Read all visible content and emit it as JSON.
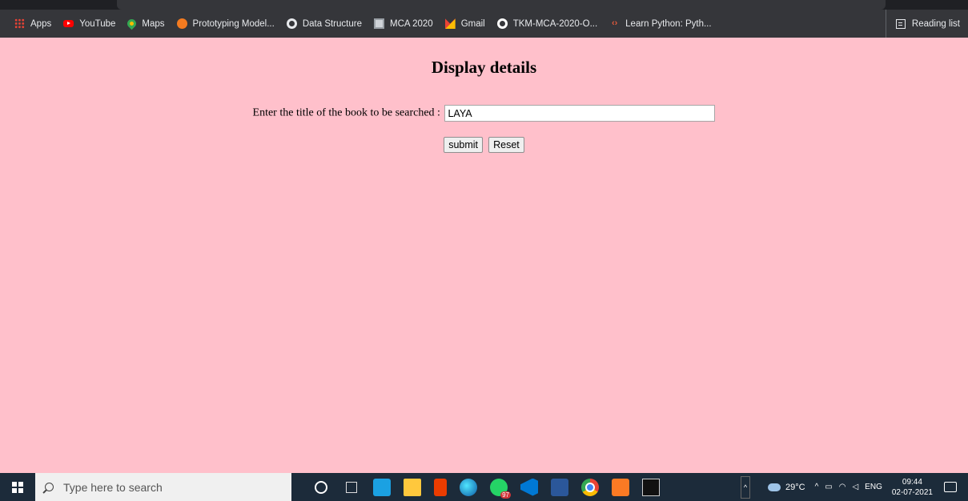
{
  "bookmarks": {
    "items": [
      {
        "label": "Apps",
        "icon": "apps-grid-icon"
      },
      {
        "label": "YouTube",
        "icon": "youtube-icon"
      },
      {
        "label": "Maps",
        "icon": "maps-pin-icon"
      },
      {
        "label": "Prototyping Model...",
        "icon": "prototyping-icon"
      },
      {
        "label": "Data Structure",
        "icon": "globe-icon"
      },
      {
        "label": "MCA 2020",
        "icon": "mca-icon"
      },
      {
        "label": "Gmail",
        "icon": "gmail-icon"
      },
      {
        "label": "TKM-MCA-2020-O...",
        "icon": "github-icon"
      },
      {
        "label": "Learn Python: Pyth...",
        "icon": "python-icon"
      }
    ],
    "reading_list": "Reading list"
  },
  "page": {
    "heading": "Display details",
    "search_label": "Enter the title of the book to be searched :",
    "search_value": "LAYA",
    "submit_label": "submit",
    "reset_label": "Reset",
    "background_color": "#ffc0cb"
  },
  "taskbar": {
    "search_placeholder": "Type here to search",
    "whatsapp_badge": "97",
    "weather": "29°C",
    "language": "ENG",
    "time": "09:44",
    "date": "02-07-2021"
  }
}
